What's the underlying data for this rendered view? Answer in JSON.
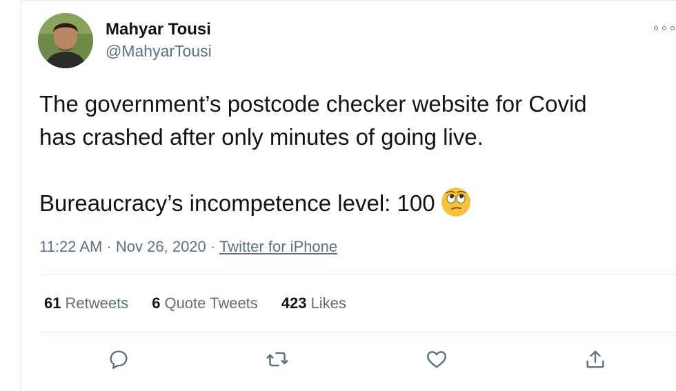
{
  "author": {
    "name": "Mahyar Tousi",
    "handle": "@MahyarTousi"
  },
  "tweet": {
    "line1": "The government’s postcode checker website for Covid",
    "line2": "has crashed after only minutes of going live.",
    "line3": "Bureaucracy’s incompetence level: 100",
    "emoji": "face-with-rolling-eyes-emoji"
  },
  "meta": {
    "time": "11:22 AM",
    "sep1": "·",
    "date": "Nov 26, 2020",
    "sep2": "·",
    "source": "Twitter for iPhone"
  },
  "stats": {
    "retweets_count": "61",
    "retweets_label": "Retweets",
    "quotes_count": "6",
    "quotes_label": "Quote Tweets",
    "likes_count": "423",
    "likes_label": "Likes"
  },
  "actions": {
    "reply_icon": "reply-icon",
    "retweet_icon": "retweet-icon",
    "like_icon": "heart-icon",
    "share_icon": "share-icon"
  },
  "colors": {
    "text": "#0f1419",
    "secondary": "#5b7083",
    "border": "#e1e8ed",
    "emoji": "#f5c33b"
  }
}
